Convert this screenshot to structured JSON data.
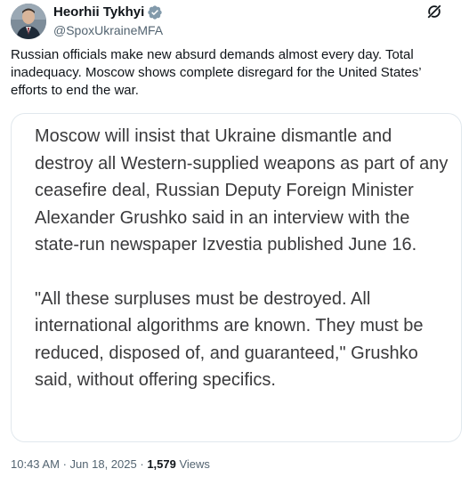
{
  "author": {
    "name": "Heorhii Tykhyi",
    "handle": "@SpoxUkraineMFA",
    "verified_color": "#829aab"
  },
  "tweet": {
    "text": "Russian officials make new absurd demands almost every day. Total inadequacy. Moscow shows complete disregard for the United States’ efforts to end the war."
  },
  "quote": {
    "paragraph1": "Moscow will insist that Ukraine dismantle and destroy all Western-supplied weapons as part of any ceasefire deal, Russian Deputy Foreign Minister Alexander Grushko said in an interview with the state-run newspaper Izvestia published June 16.",
    "paragraph2": "\"All these surpluses must be destroyed. All international algorithms are known. They must be reduced, disposed of, and guaranteed,\" Grushko said, without offering specifics."
  },
  "meta": {
    "time": "10:43 AM",
    "separator": "·",
    "date": "Jun 18, 2025",
    "views_count": "1,579",
    "views_label": "Views"
  },
  "icons": {
    "verified": "verified-badge-icon",
    "grok": "grok-icon"
  }
}
